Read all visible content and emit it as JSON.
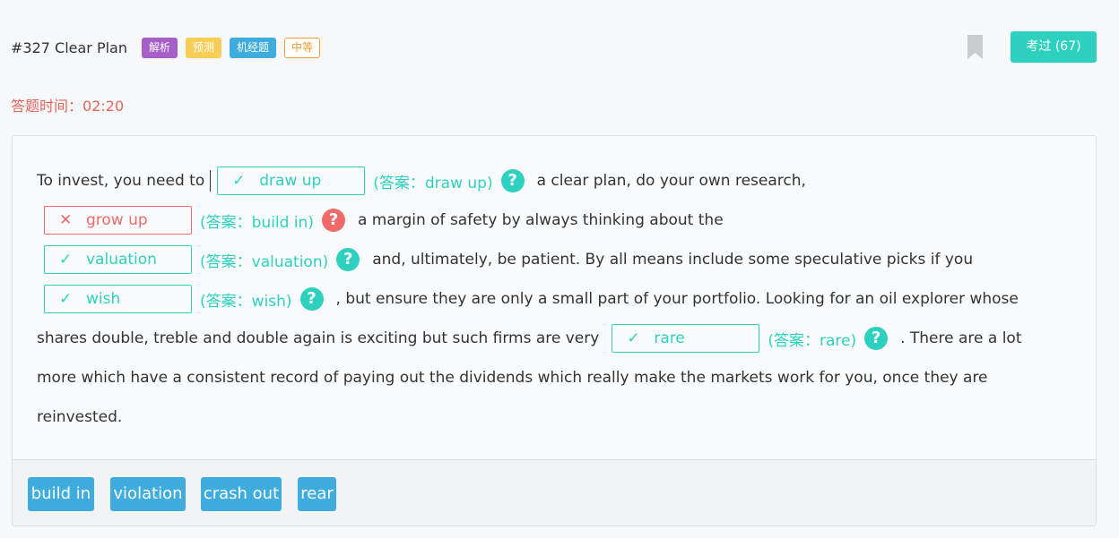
{
  "header": {
    "title": "#327 Clear Plan",
    "tags": [
      "解析",
      "预测",
      "机经题",
      "中等"
    ],
    "passed_button": "考过 (67)"
  },
  "timer": {
    "label": "答题时间：",
    "value": "02:20"
  },
  "passage": {
    "line1_text": "To invest, you need to",
    "line1_after": "a clear plan, do your own research,",
    "line2_after": "a margin of safety by always thinking about the",
    "line3_after": "and, ultimately, be patient. By all means include some speculative picks if you",
    "line4_after": ", but ensure they are only a small part of your portfolio. Looking for an oil explorer whose",
    "line5_before": "shares double, treble and double again is exciting but such firms are very",
    "line5_after": ". There are a lot",
    "line6_text": "more which have a consistent record of paying out the dividends which really make the markets work for you, once they are",
    "line7_text": "reinvested."
  },
  "blanks": [
    {
      "filled": "draw up",
      "answer": "(答案：draw up)",
      "status": "correct"
    },
    {
      "filled": "grow up",
      "answer": "(答案：build in)",
      "status": "wrong"
    },
    {
      "filled": "valuation",
      "answer": "(答案：valuation)",
      "status": "correct"
    },
    {
      "filled": "wish",
      "answer": "(答案：wish)",
      "status": "correct"
    },
    {
      "filled": "rare",
      "answer": "(答案：rare)",
      "status": "correct"
    }
  ],
  "marks": {
    "correct": "✓",
    "wrong": "✕",
    "help": "?"
  },
  "options": [
    "build in",
    "violation",
    "crash out",
    "rear"
  ],
  "colors": {
    "teal": "#2ed1bf",
    "red": "#ef6a6a",
    "blue": "#3eadde",
    "purple": "#a65fc8",
    "yellow": "#f7cd58",
    "orange": "#f0a031",
    "timer": "#e8645a"
  }
}
